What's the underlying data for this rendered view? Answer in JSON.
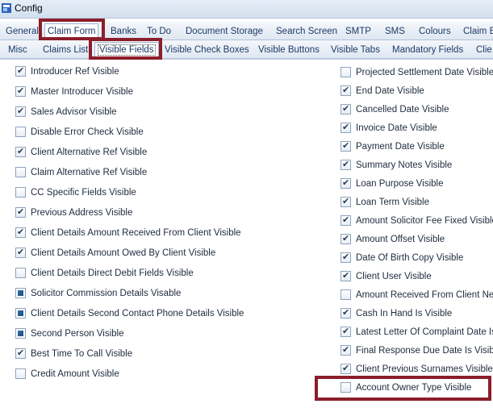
{
  "window": {
    "title": "Config"
  },
  "tabs_row1": [
    {
      "label": "General"
    },
    {
      "label": "Claim Form",
      "active": true
    },
    {
      "label": "Banks"
    },
    {
      "label": "To Do"
    },
    {
      "label": "Document Storage"
    },
    {
      "label": "Search Screen"
    },
    {
      "label": "SMTP"
    },
    {
      "label": "SMS"
    },
    {
      "label": "Colours"
    },
    {
      "label": "Claim E"
    }
  ],
  "tabs_row2": [
    {
      "label": "Misc"
    },
    {
      "label": "Claims List"
    },
    {
      "label": "Visible Fields",
      "active": true
    },
    {
      "label": "Visible Check Boxes"
    },
    {
      "label": "Visible Buttons"
    },
    {
      "label": "Visible Tabs"
    },
    {
      "label": "Mandatory Fields"
    },
    {
      "label": "Clie"
    }
  ],
  "left_column": [
    {
      "label": "Introducer Ref Visible",
      "state": "checked"
    },
    {
      "label": "Master Introducer Visible",
      "state": "checked"
    },
    {
      "label": "Sales Advisor Visible",
      "state": "checked"
    },
    {
      "label": "Disable Error Check Visible",
      "state": "unchecked"
    },
    {
      "label": "Client Alternative Ref Visible",
      "state": "checked"
    },
    {
      "label": "Claim Alternative Ref Visible",
      "state": "unchecked"
    },
    {
      "label": "CC Specific Fields Visible",
      "state": "unchecked"
    },
    {
      "label": "Previous Address Visible",
      "state": "checked"
    },
    {
      "label": "Client Details Amount Received From Client Visible",
      "state": "checked"
    },
    {
      "label": "Client Details Amount Owed By Client Visible",
      "state": "checked"
    },
    {
      "label": "Client Details Direct Debit Fields Visible",
      "state": "unchecked"
    },
    {
      "label": "Solicitor Commission Details Visable",
      "state": "indeterminate"
    },
    {
      "label": "Client Details Second Contact Phone Details Visible",
      "state": "indeterminate"
    },
    {
      "label": "Second Person Visible",
      "state": "indeterminate"
    },
    {
      "label": "Best Time To Call Visible",
      "state": "checked"
    },
    {
      "label": "Credit Amount Visible",
      "state": "unchecked"
    }
  ],
  "right_column": [
    {
      "label": "Projected Settlement Date Visible",
      "state": "unchecked"
    },
    {
      "label": "End Date Visible",
      "state": "checked"
    },
    {
      "label": "Cancelled Date Visible",
      "state": "checked"
    },
    {
      "label": " Invoice Date Visible",
      "state": "checked"
    },
    {
      "label": "Payment Date Visible",
      "state": "checked"
    },
    {
      "label": "Summary Notes Visible",
      "state": "checked"
    },
    {
      "label": "Loan Purpose Visible",
      "state": "checked"
    },
    {
      "label": "Loan Term Visible",
      "state": "checked"
    },
    {
      "label": "Amount Solicitor Fee Fixed Visible",
      "state": "checked"
    },
    {
      "label": "Amount Offset Visible",
      "state": "checked"
    },
    {
      "label": "Date Of Birth Copy Visible",
      "state": "checked"
    },
    {
      "label": "Client User Visible",
      "state": "checked"
    },
    {
      "label": "Amount Received From Client Net",
      "state": "unchecked"
    },
    {
      "label": "Cash In Hand Is Visible",
      "state": "checked"
    },
    {
      "label": "Latest Letter Of Complaint Date Is",
      "state": "checked"
    },
    {
      "label": "Final Response Due Date Is Visible",
      "state": "checked"
    },
    {
      "label": "Client Previous Surnames Visible",
      "state": "checked"
    },
    {
      "label": "Account Owner Type Visible",
      "state": "unchecked"
    }
  ],
  "colors": {
    "highlight": "#8b1e2a",
    "tab_text": "#1c3a66",
    "indeterminate": "#1c4f7e"
  }
}
